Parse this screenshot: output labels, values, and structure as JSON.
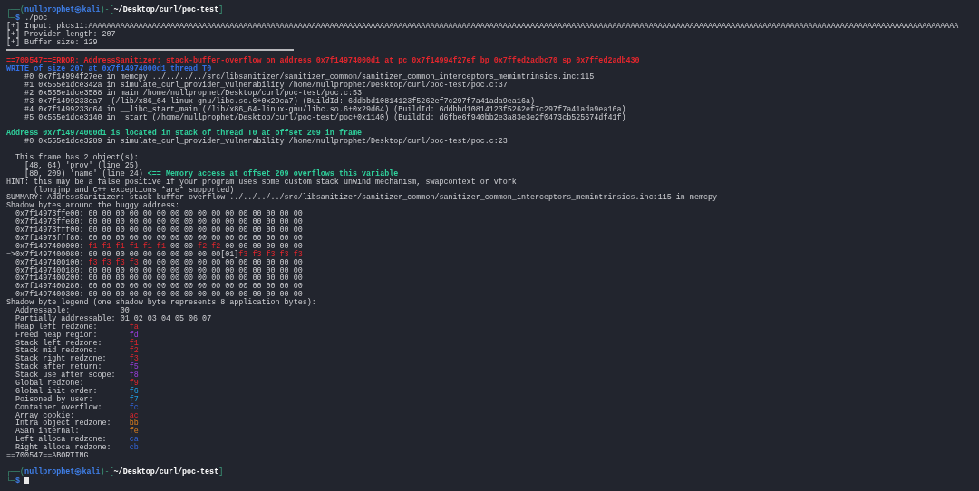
{
  "terminal": {
    "lines": [
      {
        "kind": "prompt",
        "segments": [
          {
            "text": "┌──(",
            "kind": "frame"
          },
          {
            "text": "nullprophet㉿kali",
            "kind": "user"
          },
          {
            "text": ")-[",
            "kind": "frame"
          },
          {
            "text": "~/Desktop/curl/poc-test",
            "kind": "path"
          },
          {
            "text": "]",
            "kind": "frame"
          }
        ]
      },
      {
        "kind": "command",
        "segments": [
          {
            "text": "└─",
            "kind": "frame"
          },
          {
            "text": "$ ",
            "kind": "user"
          },
          {
            "text": "./poc",
            "kind": "cmd"
          }
        ]
      },
      {
        "kind": "output",
        "segments": [
          {
            "text": "[+] Input: pkcs11:AAAAAAAAAAAAAAAAAAAAAAAAAAAAAAAAAAAAAAAAAAAAAAAAAAAAAAAAAAAAAAAAAAAAAAAAAAAAAAAAAAAAAAAAAAAAAAAAAAAAAAAAAAAAAAAAAAAAAAAAAAAAAAAAAAAAAAAAAAAAAAAAAAAAAAAAAAAAAAAAAAAAAAAAAAAAAAAAAAAAAAAAAAAAAAA",
            "kind": "plain"
          }
        ]
      },
      {
        "kind": "output",
        "segments": [
          {
            "text": "[+] Provider length: 207",
            "kind": "plain"
          }
        ]
      },
      {
        "kind": "output",
        "segments": [
          {
            "text": "[+] Buffer size: 129",
            "kind": "plain"
          }
        ]
      },
      {
        "kind": "rule"
      },
      {
        "kind": "output",
        "segments": [
          {
            "text": "==700547==ERROR: AddressSanitizer: stack-buffer-overflow on address 0x7f14974000d1 at pc 0x7f14994f27ef bp 0x7ffed2adbc70 sp 0x7ffed2adb430",
            "kind": "error"
          }
        ]
      },
      {
        "kind": "output",
        "segments": [
          {
            "text": "WRITE of size 207 at 0x7f14974000d1 thread T0",
            "kind": "blue-bold"
          }
        ]
      },
      {
        "kind": "output",
        "segments": [
          {
            "text": "    #0 0x7f14994f27ee in memcpy ../../../../src/libsanitizer/sanitizer_common/sanitizer_common_interceptors_memintrinsics.inc:115",
            "kind": "plain"
          }
        ]
      },
      {
        "kind": "output",
        "segments": [
          {
            "text": "    #1 0x555e1dce342a in simulate_curl_provider_vulnerability /home/nullprophet/Desktop/curl/poc-test/poc.c:37",
            "kind": "plain"
          }
        ]
      },
      {
        "kind": "output",
        "segments": [
          {
            "text": "    #2 0x555e1dce3588 in main /home/nullprophet/Desktop/curl/poc-test/poc.c:53",
            "kind": "plain"
          }
        ]
      },
      {
        "kind": "output",
        "segments": [
          {
            "text": "    #3 0x7f1499233ca7  (/lib/x86_64-linux-gnu/libc.so.6+0x29ca7) (BuildId: 6ddbbd10814123f5262ef7c297f7a41ada9ea16a)",
            "kind": "plain"
          }
        ]
      },
      {
        "kind": "output",
        "segments": [
          {
            "text": "    #4 0x7f1499233d64 in __libc_start_main (/lib/x86_64-linux-gnu/libc.so.6+0x29d64) (BuildId: 6ddbbd10814123f5262ef7c297f7a41ada9ea16a)",
            "kind": "plain"
          }
        ]
      },
      {
        "kind": "output",
        "segments": [
          {
            "text": "    #5 0x555e1dce3140 in _start (/home/nullprophet/Desktop/curl/poc-test/poc+0x1140) (BuildId: d6fbe6f940bb2e3a83e3e2f0473cb525674df41f)",
            "kind": "plain"
          }
        ]
      },
      {
        "kind": "blank"
      },
      {
        "kind": "output",
        "segments": [
          {
            "text": "Address 0x7f14974000d1 is located in stack of thread T0 at offset 209 in frame",
            "kind": "green-bold"
          }
        ]
      },
      {
        "kind": "output",
        "segments": [
          {
            "text": "    #0 0x555e1dce3289 in simulate_curl_provider_vulnerability /home/nullprophet/Desktop/curl/poc-test/poc.c:23",
            "kind": "plain"
          }
        ]
      },
      {
        "kind": "blank"
      },
      {
        "kind": "output",
        "segments": [
          {
            "text": "  This frame has 2 object(s):",
            "kind": "plain"
          }
        ]
      },
      {
        "kind": "output",
        "segments": [
          {
            "text": "    [48, 64) 'prov' (line 25)",
            "kind": "plain"
          }
        ]
      },
      {
        "kind": "output",
        "segments": [
          {
            "text": "    [80, 209) 'name' (line 24) ",
            "kind": "plain"
          },
          {
            "text": "<== Memory access at offset 209 overflows this variable",
            "kind": "green-bold"
          }
        ]
      },
      {
        "kind": "output",
        "segments": [
          {
            "text": "HINT: this may be a false positive if your program uses some custom stack unwind mechanism, swapcontext or vfork",
            "kind": "plain"
          }
        ]
      },
      {
        "kind": "output",
        "segments": [
          {
            "text": "      (longjmp and C++ exceptions *are* supported)",
            "kind": "plain"
          }
        ]
      },
      {
        "kind": "output",
        "segments": [
          {
            "text": "SUMMARY: AddressSanitizer: stack-buffer-overflow ../../../../src/libsanitizer/sanitizer_common/sanitizer_common_interceptors_memintrinsics.inc:115 in memcpy",
            "kind": "plain"
          }
        ]
      },
      {
        "kind": "output",
        "segments": [
          {
            "text": "Shadow bytes around the buggy address:",
            "kind": "plain"
          }
        ]
      },
      {
        "kind": "output",
        "segments": [
          {
            "text": "  0x7f14973ffe00: 00 00 00 00 00 00 00 00 00 00 00 00 00 00 00 00",
            "kind": "plain"
          }
        ]
      },
      {
        "kind": "output",
        "segments": [
          {
            "text": "  0x7f14973ffe80: 00 00 00 00 00 00 00 00 00 00 00 00 00 00 00 00",
            "kind": "plain"
          }
        ]
      },
      {
        "kind": "output",
        "segments": [
          {
            "text": "  0x7f14973fff00: 00 00 00 00 00 00 00 00 00 00 00 00 00 00 00 00",
            "kind": "plain"
          }
        ]
      },
      {
        "kind": "output",
        "segments": [
          {
            "text": "  0x7f14973fff80: 00 00 00 00 00 00 00 00 00 00 00 00 00 00 00 00",
            "kind": "plain"
          }
        ]
      },
      {
        "kind": "output",
        "segments": [
          {
            "text": "  0x7f1497400000: ",
            "kind": "plain"
          },
          {
            "text": "f1 f1 f1 f1 f1 f1",
            "kind": "red"
          },
          {
            "text": " 00 00 ",
            "kind": "plain"
          },
          {
            "text": "f2 f2",
            "kind": "red"
          },
          {
            "text": " 00 00 00 00 00 00",
            "kind": "plain"
          }
        ]
      },
      {
        "kind": "output",
        "segments": [
          {
            "text": "=>0x7f1497400080: 00 00 00 00 00 00 00 00 00 00[01]",
            "kind": "plain"
          },
          {
            "text": "f3 f3 f3 f3 f3",
            "kind": "red"
          }
        ]
      },
      {
        "kind": "output",
        "segments": [
          {
            "text": "  0x7f1497400100: ",
            "kind": "plain"
          },
          {
            "text": "f3 f3 f3 f3",
            "kind": "red"
          },
          {
            "text": " 00 00 00 00 00 00 00 00 00 00 00 00",
            "kind": "plain"
          }
        ]
      },
      {
        "kind": "output",
        "segments": [
          {
            "text": "  0x7f1497400180: 00 00 00 00 00 00 00 00 00 00 00 00 00 00 00 00",
            "kind": "plain"
          }
        ]
      },
      {
        "kind": "output",
        "segments": [
          {
            "text": "  0x7f1497400200: 00 00 00 00 00 00 00 00 00 00 00 00 00 00 00 00",
            "kind": "plain"
          }
        ]
      },
      {
        "kind": "output",
        "segments": [
          {
            "text": "  0x7f1497400280: 00 00 00 00 00 00 00 00 00 00 00 00 00 00 00 00",
            "kind": "plain"
          }
        ]
      },
      {
        "kind": "output",
        "segments": [
          {
            "text": "  0x7f1497400300: 00 00 00 00 00 00 00 00 00 00 00 00 00 00 00 00",
            "kind": "plain"
          }
        ]
      },
      {
        "kind": "output",
        "segments": [
          {
            "text": "Shadow byte legend (one shadow byte represents 8 application bytes):",
            "kind": "plain"
          }
        ]
      },
      {
        "kind": "output",
        "segments": [
          {
            "text": "  Addressable:           00",
            "kind": "plain"
          }
        ]
      },
      {
        "kind": "output",
        "segments": [
          {
            "text": "  Partially addressable: 01 02 03 04 05 06 07",
            "kind": "plain"
          }
        ]
      },
      {
        "kind": "output",
        "segments": [
          {
            "text": "  Heap left redzone:       ",
            "kind": "plain"
          },
          {
            "text": "fa",
            "kind": "red"
          }
        ]
      },
      {
        "kind": "output",
        "segments": [
          {
            "text": "  Freed heap region:       ",
            "kind": "plain"
          },
          {
            "text": "fd",
            "kind": "purple"
          }
        ]
      },
      {
        "kind": "output",
        "segments": [
          {
            "text": "  Stack left redzone:      ",
            "kind": "plain"
          },
          {
            "text": "f1",
            "kind": "red"
          }
        ]
      },
      {
        "kind": "output",
        "segments": [
          {
            "text": "  Stack mid redzone:       ",
            "kind": "plain"
          },
          {
            "text": "f2",
            "kind": "red"
          }
        ]
      },
      {
        "kind": "output",
        "segments": [
          {
            "text": "  Stack right redzone:     ",
            "kind": "plain"
          },
          {
            "text": "f3",
            "kind": "red"
          }
        ]
      },
      {
        "kind": "output",
        "segments": [
          {
            "text": "  Stack after return:      ",
            "kind": "plain"
          },
          {
            "text": "f5",
            "kind": "purple"
          }
        ]
      },
      {
        "kind": "output",
        "segments": [
          {
            "text": "  Stack use after scope:   ",
            "kind": "plain"
          },
          {
            "text": "f8",
            "kind": "purple"
          }
        ]
      },
      {
        "kind": "output",
        "segments": [
          {
            "text": "  Global redzone:          ",
            "kind": "plain"
          },
          {
            "text": "f9",
            "kind": "red"
          }
        ]
      },
      {
        "kind": "output",
        "segments": [
          {
            "text": "  Global init order:       ",
            "kind": "plain"
          },
          {
            "text": "f6",
            "kind": "cyan"
          }
        ]
      },
      {
        "kind": "output",
        "segments": [
          {
            "text": "  Poisoned by user:        ",
            "kind": "plain"
          },
          {
            "text": "f7",
            "kind": "cyan"
          }
        ]
      },
      {
        "kind": "output",
        "segments": [
          {
            "text": "  Container overflow:      ",
            "kind": "plain"
          },
          {
            "text": "fc",
            "kind": "blue"
          }
        ]
      },
      {
        "kind": "output",
        "segments": [
          {
            "text": "  Array cookie:            ",
            "kind": "plain"
          },
          {
            "text": "ac",
            "kind": "red"
          }
        ]
      },
      {
        "kind": "output",
        "segments": [
          {
            "text": "  Intra object redzone:    ",
            "kind": "plain"
          },
          {
            "text": "bb",
            "kind": "orange"
          }
        ]
      },
      {
        "kind": "output",
        "segments": [
          {
            "text": "  ASan internal:           ",
            "kind": "plain"
          },
          {
            "text": "fe",
            "kind": "orange"
          }
        ]
      },
      {
        "kind": "output",
        "segments": [
          {
            "text": "  Left alloca redzone:     ",
            "kind": "plain"
          },
          {
            "text": "ca",
            "kind": "blue"
          }
        ]
      },
      {
        "kind": "output",
        "segments": [
          {
            "text": "  Right alloca redzone:    ",
            "kind": "plain"
          },
          {
            "text": "cb",
            "kind": "blue"
          }
        ]
      },
      {
        "kind": "output",
        "segments": [
          {
            "text": "==700547==ABORTING",
            "kind": "plain"
          }
        ]
      },
      {
        "kind": "blank"
      },
      {
        "kind": "prompt",
        "segments": [
          {
            "text": "┌──(",
            "kind": "frame"
          },
          {
            "text": "nullprophet㉿kali",
            "kind": "user"
          },
          {
            "text": ")-[",
            "kind": "frame"
          },
          {
            "text": "~/Desktop/curl/poc-test",
            "kind": "path"
          },
          {
            "text": "]",
            "kind": "frame"
          }
        ]
      },
      {
        "kind": "cursor",
        "segments": [
          {
            "text": "└─",
            "kind": "frame"
          },
          {
            "text": "$ ",
            "kind": "user"
          }
        ]
      }
    ]
  }
}
